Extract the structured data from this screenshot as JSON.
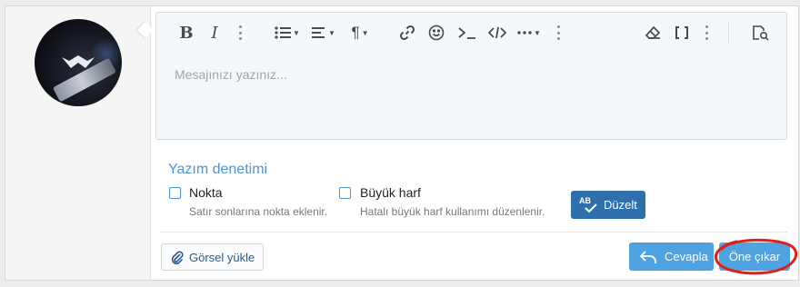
{
  "editor": {
    "placeholder": "Mesajınızı yazınız..."
  },
  "toolbar": {
    "buttons": [
      "bold-icon",
      "italic-icon",
      "more-vertical-icon",
      "list-icon",
      "align-icon",
      "paragraph-icon",
      "link-icon",
      "smiley-icon",
      "inline-code-icon",
      "code-icon",
      "more-horizontal-icon",
      "more-vertical-icon",
      "eraser-icon",
      "brackets-icon",
      "more-vertical-icon",
      "preview-icon"
    ]
  },
  "spellcheck": {
    "title": "Yazım denetimi",
    "options": [
      {
        "label": "Nokta",
        "description": "Satır sonlarına nokta eklenir.",
        "checked": false
      },
      {
        "label": "Büyük harf",
        "description": "Hatalı büyük harf kullanımı düzenlenir.",
        "checked": false
      }
    ],
    "fix_icon_text": "AB",
    "fix_label": "Düzelt"
  },
  "footer": {
    "upload_label": "Görsel yükle",
    "reply_label": "Cevapla",
    "promote_label": "Öne çıkar"
  },
  "colors": {
    "accent": "#4fa3e0",
    "dark_accent": "#2f6fae",
    "annotation": "#e0201a"
  }
}
